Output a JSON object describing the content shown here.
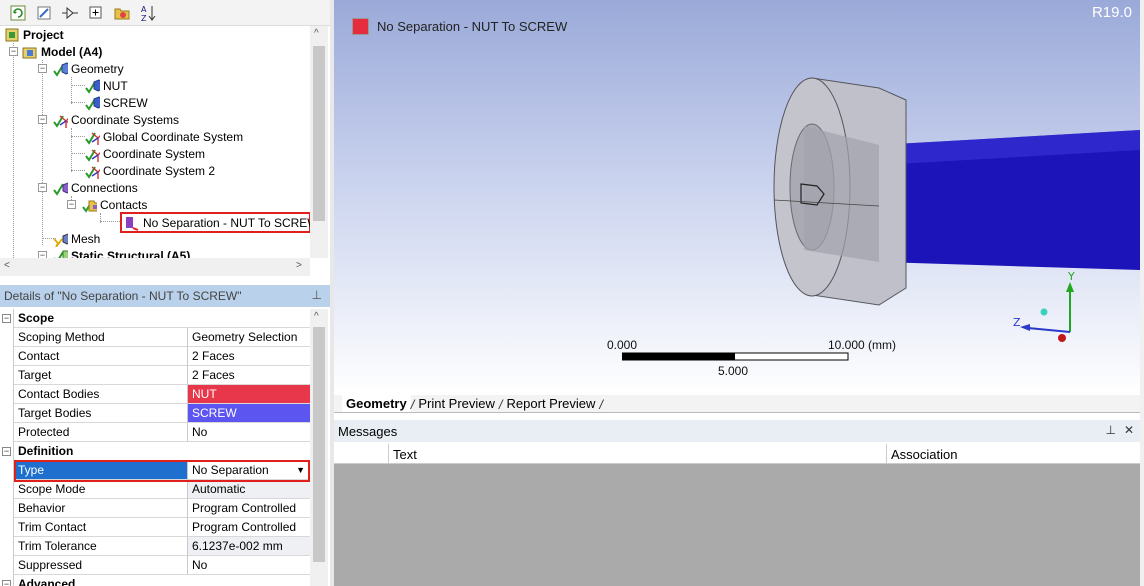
{
  "version": "R19.0",
  "legend": {
    "label": "No Separation - NUT To SCREW",
    "color": "#e52d3f"
  },
  "tree": {
    "project": "Project",
    "model": "Model (A4)",
    "geometry": "Geometry",
    "nut": "NUT",
    "screw": "SCREW",
    "coord_systems": "Coordinate Systems",
    "global_cs": "Global Coordinate System",
    "cs1": "Coordinate System",
    "cs2": "Coordinate System 2",
    "connections": "Connections",
    "contacts": "Contacts",
    "contact_item": "No Separation - NUT To SCREW",
    "mesh": "Mesh",
    "static": "Static Structural (A5)"
  },
  "details": {
    "title": "Details of \"No Separation - NUT To SCREW\"",
    "scope_label": "Scope",
    "scoping_method": {
      "k": "Scoping Method",
      "v": "Geometry Selection"
    },
    "contact": {
      "k": "Contact",
      "v": "2 Faces"
    },
    "target": {
      "k": "Target",
      "v": "2 Faces"
    },
    "contact_bodies": {
      "k": "Contact Bodies",
      "v": "NUT",
      "color": "#e8374a"
    },
    "target_bodies": {
      "k": "Target Bodies",
      "v": "SCREW",
      "color": "#5d55f0"
    },
    "protected": {
      "k": "Protected",
      "v": "No"
    },
    "definition_label": "Definition",
    "type": {
      "k": "Type",
      "v": "No Separation"
    },
    "scope_mode": {
      "k": "Scope Mode",
      "v": "Automatic"
    },
    "behavior": {
      "k": "Behavior",
      "v": "Program Controlled"
    },
    "trim_contact": {
      "k": "Trim Contact",
      "v": "Program Controlled"
    },
    "trim_tolerance": {
      "k": "Trim Tolerance",
      "v": "6.1237e-002 mm"
    },
    "suppressed": {
      "k": "Suppressed",
      "v": "No"
    },
    "advanced_label": "Advanced"
  },
  "scale": {
    "left": "0.000",
    "right": "10.000 (mm)",
    "mid": "5.000"
  },
  "triad": {
    "y": "Y",
    "z": "Z"
  },
  "view_tabs": [
    "Geometry",
    "Print Preview",
    "Report Preview"
  ],
  "messages": {
    "title": "Messages",
    "col_text": "Text",
    "col_assoc": "Association"
  }
}
